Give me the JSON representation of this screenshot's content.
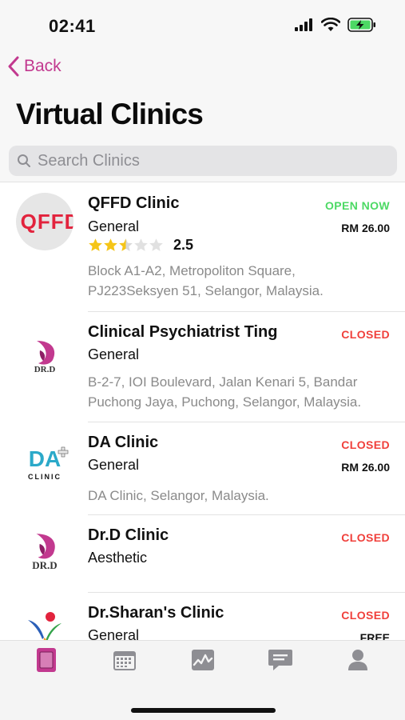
{
  "status_bar": {
    "time": "02:41"
  },
  "nav": {
    "back_label": "Back",
    "title": "Virtual Clinics"
  },
  "search": {
    "placeholder": "Search Clinics"
  },
  "clinics": [
    {
      "logo_text": "QFFD",
      "name": "QFFD Clinic",
      "category": "General",
      "status": "OPEN NOW",
      "price": "RM 26.00",
      "rating": 2.5,
      "rating_label": "2.5",
      "address": "Block A1-A2, Metropoliton Square, PJ223Seksyen 51, Selangor, Malaysia."
    },
    {
      "logo_text": "DR.D",
      "name": "Clinical Psychiatrist Ting",
      "category": "General",
      "status": "CLOSED",
      "address": "B-2-7, IOI Boulevard, Jalan Kenari 5, Bandar Puchong Jaya, Puchong, Selangor, Malaysia."
    },
    {
      "logo_text": "DA",
      "logo_subtext": "CLINIC",
      "name": "DA Clinic",
      "category": "General",
      "status": "CLOSED",
      "price": "RM 26.00",
      "address": "DA Clinic, Selangor, Malaysia."
    },
    {
      "logo_text": "DR.D",
      "name": "Dr.D Clinic",
      "category": "Aesthetic",
      "status": "CLOSED"
    },
    {
      "name": "Dr.Sharan's Clinic",
      "category": "General",
      "status": "CLOSED",
      "price": "FREE"
    }
  ],
  "tabs": [
    {
      "icon": "clinic-card-icon",
      "active": true
    },
    {
      "icon": "calendar-icon",
      "active": false
    },
    {
      "icon": "activity-chart-icon",
      "active": false
    },
    {
      "icon": "chat-bubble-icon",
      "active": false
    },
    {
      "icon": "profile-icon",
      "active": false
    }
  ],
  "colors": {
    "accent": "#c2398f",
    "open": "#4cd964",
    "closed": "#f0403b",
    "muted": "#8a8a8a"
  }
}
